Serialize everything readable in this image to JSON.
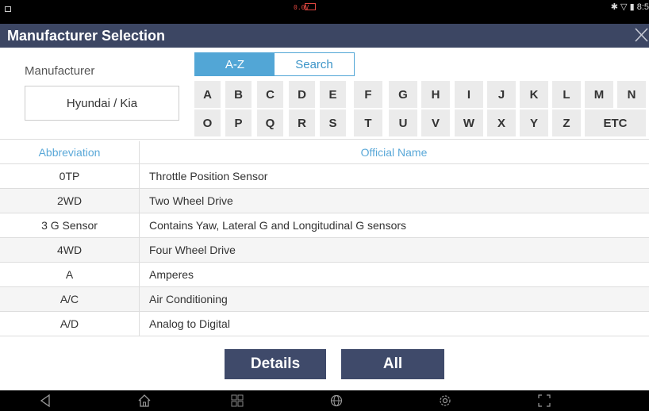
{
  "status_bar": {
    "voltage": "0.0V",
    "time": "8:5"
  },
  "title": "Manufacturer Selection",
  "manufacturer": {
    "label": "Manufacturer",
    "value": "Hyundai / Kia"
  },
  "tabs": [
    {
      "label": "A-Z",
      "active": true
    },
    {
      "label": "Search",
      "active": false
    }
  ],
  "letters_row1": [
    "A",
    "B",
    "C",
    "D",
    "E",
    "F",
    "G",
    "H",
    "I",
    "J",
    "K",
    "L",
    "M",
    "N"
  ],
  "letters_row2": [
    "O",
    "P",
    "Q",
    "R",
    "S",
    "T",
    "U",
    "V",
    "W",
    "X",
    "Y",
    "Z",
    "ETC"
  ],
  "table": {
    "headers": {
      "abbreviation": "Abbreviation",
      "official_name": "Official Name"
    },
    "rows": [
      {
        "abbr": "0TP",
        "name": "Throttle Position Sensor"
      },
      {
        "abbr": "2WD",
        "name": "Two Wheel Drive"
      },
      {
        "abbr": "3 G Sensor",
        "name": "Contains Yaw, Lateral G and Longitudinal G sensors"
      },
      {
        "abbr": "4WD",
        "name": "Four Wheel Drive"
      },
      {
        "abbr": "A",
        "name": "Amperes"
      },
      {
        "abbr": "A/C",
        "name": "Air Conditioning"
      },
      {
        "abbr": "A/D",
        "name": "Analog to Digital"
      }
    ]
  },
  "buttons": {
    "details": "Details",
    "all": "All"
  },
  "nav_icons": [
    "back-icon",
    "home-icon",
    "recent-apps-icon",
    "browser-icon",
    "settings-icon",
    "screenshot-icon"
  ],
  "colors": {
    "title_bar": "#3c4663",
    "accent": "#52a6d6",
    "button": "#3f4a6a"
  }
}
